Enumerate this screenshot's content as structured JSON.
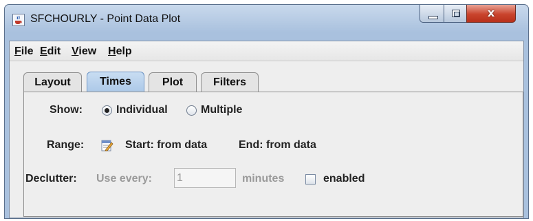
{
  "window": {
    "title": "SFCHOURLY - Point Data Plot",
    "close_glyph": "x"
  },
  "menu": [
    {
      "label": "File"
    },
    {
      "label": "Edit"
    },
    {
      "label": "View"
    },
    {
      "label": "Help"
    }
  ],
  "tabs": [
    {
      "label": "Layout"
    },
    {
      "label": "Times",
      "selected": true
    },
    {
      "label": "Plot"
    },
    {
      "label": "Filters"
    }
  ],
  "times": {
    "show_label": "Show:",
    "show_options": [
      {
        "label": "Individual",
        "selected": true
      },
      {
        "label": "Multiple",
        "selected": false
      }
    ],
    "range_label": "Range:",
    "range_start": "Start: from data",
    "range_end": "End: from data",
    "declutter_label": "Declutter:",
    "use_every_label": "Use every:",
    "use_every_value": "1",
    "minutes_label": "minutes",
    "enabled_label": "enabled",
    "enabled_checked": false
  },
  "icons": {
    "app": "java-cup-icon",
    "range_edit": "edit-pencil-icon",
    "minimize": "minimize-icon",
    "maximize": "maximize-icon",
    "close": "close-icon"
  },
  "colors": {
    "title_bar": "#a9c1de",
    "selected_tab": "#adc9e8",
    "close_button": "#c9442d",
    "disabled_text": "#9a9a9a"
  }
}
